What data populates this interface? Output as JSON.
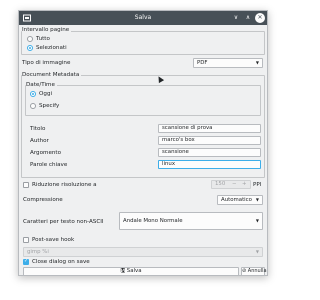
{
  "window": {
    "title": "Salva"
  },
  "page_range": {
    "label": "Intervallo pagine",
    "options": [
      "Tutto",
      "Selezionati"
    ],
    "selected": "Selezionati"
  },
  "image_type": {
    "label": "Tipo di immagine",
    "value": "PDF"
  },
  "metadata": {
    "label": "Document Metadata",
    "date_time": {
      "label": "Date/Time",
      "options": [
        "Oggi",
        "Specify"
      ],
      "selected": "Oggi"
    },
    "fields": [
      {
        "label": "Titolo",
        "value": "scansione di prova"
      },
      {
        "label": "Author",
        "value": "marco's box"
      },
      {
        "label": "Argomento",
        "value": "scansione"
      },
      {
        "label": "Parole chiave",
        "value": "linux"
      }
    ]
  },
  "resolution": {
    "label": "Riduzione risoluzione a",
    "value": "150",
    "unit": "PPI",
    "checked": false
  },
  "compression": {
    "label": "Compressione",
    "value": "Automatico"
  },
  "fallback_font": {
    "label": "Caratteri per testo non-ASCII",
    "value": "Andale Mono Normale"
  },
  "post_save_hook": {
    "label": "Post-save hook",
    "checked": false,
    "value": "gimp %i"
  },
  "close_dialog": {
    "label": "Close dialog on save",
    "checked": true
  },
  "buttons": {
    "save": "Salva",
    "cancel": "Annulla"
  },
  "icons": {
    "app": "app-icon",
    "minimize": "minimize-icon",
    "maximize": "maximize-icon",
    "close": "close-icon"
  }
}
